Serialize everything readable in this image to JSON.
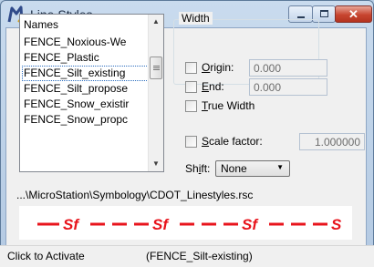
{
  "window": {
    "title": "Line Styles",
    "icon": "line-styles-app-icon",
    "buttons": [
      "minimize",
      "maximize",
      "close"
    ]
  },
  "names_list": {
    "header": "Names",
    "items": [
      "FENCE_Noxious-We",
      "FENCE_Plastic",
      "FENCE_Silt_existing",
      "FENCE_Silt_propose",
      "FENCE_Snow_existir",
      "FENCE_Snow_propc"
    ],
    "selected": "FENCE_Silt_existing"
  },
  "width_group": {
    "label": "Width",
    "origin": {
      "label": "Origin:",
      "mnemonic": "O",
      "rest": "rigin:",
      "value": "0.000"
    },
    "end": {
      "label": "End:",
      "mnemonic": "E",
      "rest": "nd:",
      "value": "0.000"
    },
    "true_width": {
      "label": "True Width",
      "mnemonic": "T",
      "rest": "rue Width"
    }
  },
  "scale_factor": {
    "label": "Scale factor:",
    "mnemonic": "S",
    "rest": "cale factor:",
    "value": "1.000000"
  },
  "shift": {
    "label": "Shift:",
    "pre": "Sh",
    "mnemonic": "i",
    "rest": "ft:",
    "value": "None"
  },
  "file_path": "...\\MicroStation\\Symbology\\CDOT_Linestyles.rsc",
  "preview": {
    "line_color": "#e8141c",
    "symbol": "Sf",
    "end_symbol": "S"
  },
  "status": {
    "left": "Click to Activate",
    "right": "(FENCE_Silt-existing)"
  }
}
